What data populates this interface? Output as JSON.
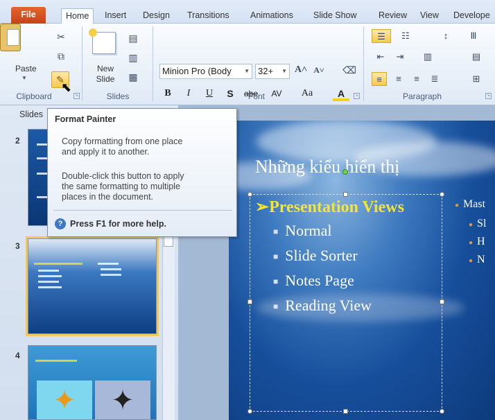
{
  "tabs": {
    "file": "File",
    "items": [
      "Home",
      "Insert",
      "Design",
      "Transitions",
      "Animations",
      "Slide Show",
      "Review",
      "View",
      "Develope"
    ]
  },
  "clipboard": {
    "paste_label": "Paste",
    "group_label": "Clipboard"
  },
  "slides_group": {
    "new_slide_label_1": "New",
    "new_slide_label_2": "Slide",
    "group_label": "Slides"
  },
  "font": {
    "font_name": "Minion Pro (Body",
    "font_size": "32+",
    "group_label": "Font",
    "bold": "B",
    "italic": "I",
    "underline": "U",
    "shadow": "S",
    "strike": "abe",
    "spacing": "AV",
    "change_case": "Aa",
    "font_color": "A"
  },
  "paragraph": {
    "group_label": "Paragraph"
  },
  "slides_pane": {
    "tab_label": "Slides",
    "thumb_numbers": [
      "2",
      "3",
      "4"
    ]
  },
  "slide": {
    "title": "Những kiểu hiển thị",
    "main_bullet": "Presentation Views",
    "sub_bullets": [
      "Normal",
      "Slide Sorter",
      "Notes Page",
      "Reading View"
    ],
    "right_col": [
      "Mast",
      "Sl",
      "H",
      "N"
    ]
  },
  "tooltip": {
    "title": "Format Painter",
    "line1": "Copy formatting from one place",
    "line2": "and apply it to another.",
    "line3": "Double-click this button to apply",
    "line4": "the same formatting to multiple",
    "line5": "places in the document.",
    "help": "Press F1 for more help."
  },
  "colors": {
    "accent_file_tab": "#d2521f",
    "highlight": "#f6c94f",
    "slide_bullet_yellow": "#f5e431"
  }
}
